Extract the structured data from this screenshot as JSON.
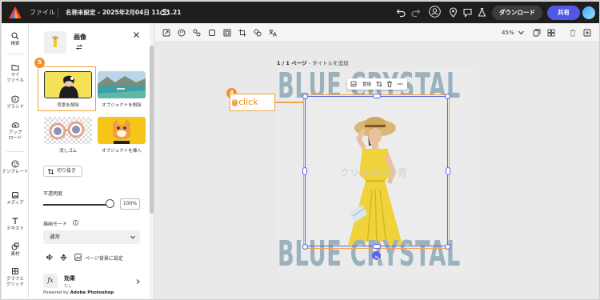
{
  "topbar": {
    "file_label": "ファイル",
    "doc_name": "名称未設定 - 2025年2月04日 11.51.21",
    "download_label": "ダウンロード",
    "share_label": "共有",
    "icons": [
      "adobe-express-logo",
      "cloud-icon",
      "undo-icon",
      "redo-icon",
      "user-icon",
      "pin-icon",
      "comment-icon",
      "flask-icon"
    ]
  },
  "rail": {
    "items": [
      {
        "icon": "search-icon",
        "label": "検索"
      },
      {
        "icon": "folder-icon",
        "label": "マイ\nファイル"
      },
      {
        "icon": "brand-icon",
        "label": "ブランド"
      },
      {
        "icon": "upload-icon",
        "label": "アップ\nロード"
      },
      {
        "icon": "template-icon",
        "label": "テンプレート"
      },
      {
        "icon": "media-icon",
        "label": "メディア"
      },
      {
        "icon": "text-icon",
        "label": "テキスト"
      },
      {
        "icon": "elements-icon",
        "label": "素材"
      },
      {
        "icon": "grid-icon",
        "label": "グラフと\nグリッド"
      }
    ]
  },
  "panel": {
    "title": "画像",
    "tools": [
      {
        "label": "背景を削除"
      },
      {
        "label": "オブジェクトを削除"
      },
      {
        "label": "消しゴム"
      },
      {
        "label": "オブジェクトを挿入"
      }
    ],
    "crop_label": "切り抜き",
    "opacity_label": "不透明度",
    "opacity_value": "100%",
    "opacity_level": 1.0,
    "blend_label": "描画モード",
    "blend_value": "通常",
    "set_bg_label": "ページ背景に設定",
    "effects_label": "効果",
    "effects_sub": "なし",
    "powered_prefix": "Powered by",
    "powered_brand": "Adobe Photoshop"
  },
  "canvas_toolbar": {
    "zoom": "45%"
  },
  "canvas": {
    "page_indicator": "1 / 1 ページ",
    "page_title_hint": " - タイトルを追加",
    "heading_top": "BLUE CRYSTAL",
    "heading_bottom": "BLUE CRYSTAL",
    "overlay_text": "クリスタルと青",
    "float_toolbar_label": "置換"
  },
  "annotations": {
    "step_5": "5",
    "step_4": "4",
    "click_label": "click"
  },
  "colors": {
    "accent": "#5c63e6",
    "highlight": "#f0a64a",
    "share": "#5258e4",
    "heading": "#9bb1bd"
  }
}
